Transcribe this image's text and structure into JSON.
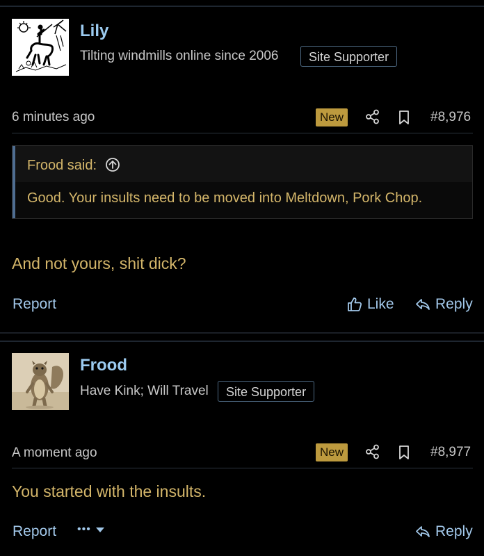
{
  "posts": [
    {
      "username": "Lily",
      "user_title": "Tilting windmills online since 2006",
      "badge": "Site Supporter",
      "time": "6 minutes ago",
      "new_label": "New",
      "post_number": "#8,976",
      "quote": {
        "author": "Frood said:",
        "text": "Good. Your insults need to be moved into Meltdown, Pork Chop."
      },
      "message": "And not yours, shit dick?",
      "actions": {
        "report": "Report",
        "like": "Like",
        "reply": "Reply"
      }
    },
    {
      "username": "Frood",
      "user_title": "Have Kink; Will Travel",
      "badge": "Site Supporter",
      "time": "A moment ago",
      "new_label": "New",
      "post_number": "#8,977",
      "message": "You started with the insults.",
      "actions": {
        "report": "Report",
        "more": "•••",
        "reply": "Reply"
      }
    }
  ],
  "colors": {
    "background": "#000000",
    "username": "#9ccbf0",
    "message": "#d4b66a",
    "new_badge": "#bd9a3e",
    "link": "#a2c8ea",
    "quote_bar": "#4f6e92"
  }
}
